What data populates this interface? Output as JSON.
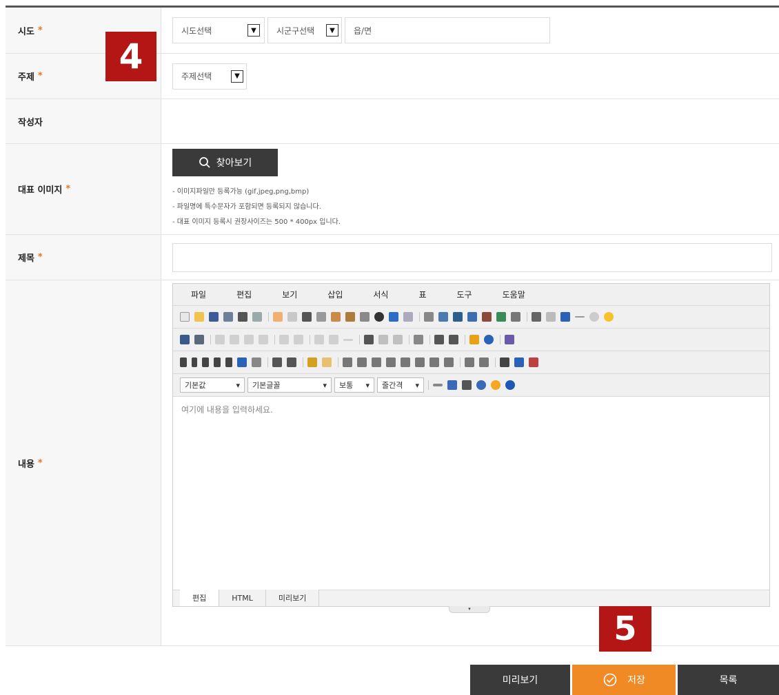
{
  "form": {
    "region": {
      "label": "시도",
      "required_mark": "*",
      "province_select": "시도선택",
      "city_select": "시군구선택",
      "town_placeholder": "읍/면"
    },
    "subject": {
      "label": "주제",
      "required_mark": "*",
      "select": "주제선택"
    },
    "author": {
      "label": "작성자"
    },
    "image": {
      "label": "대표 이미지",
      "required_mark": "*",
      "browse_label": "찾아보기",
      "notes": [
        "- 이미지파일만 등록가능 (gif,jpeg,png,bmp)",
        "- 파일명에 특수문자가 포함되면 등록되지 않습니다.",
        "- 대표 이미지 등록시 권장사이즈는 500 * 400px 입니다."
      ]
    },
    "title": {
      "label": "제목",
      "required_mark": "*"
    },
    "content": {
      "label": "내용",
      "required_mark": "*"
    }
  },
  "editor": {
    "menu": [
      "파일",
      "편집",
      "보기",
      "삽입",
      "서식",
      "표",
      "도구",
      "도움말"
    ],
    "dropdowns": [
      "기본값",
      "기본글꼴",
      "보통",
      "줄간격"
    ],
    "placeholder": "여기에 내용을 입력하세요.",
    "tabs": [
      "편집",
      "HTML",
      "미리보기"
    ],
    "resize_glyph": "▾"
  },
  "badges": {
    "step4": "4",
    "step5": "5"
  },
  "actions": {
    "preview": "미리보기",
    "save": "저장",
    "list": "목록"
  },
  "colors": {
    "badge": "#b41616",
    "save": "#f08a24",
    "dark_button": "#3a3a3a",
    "required": "#e87722"
  }
}
